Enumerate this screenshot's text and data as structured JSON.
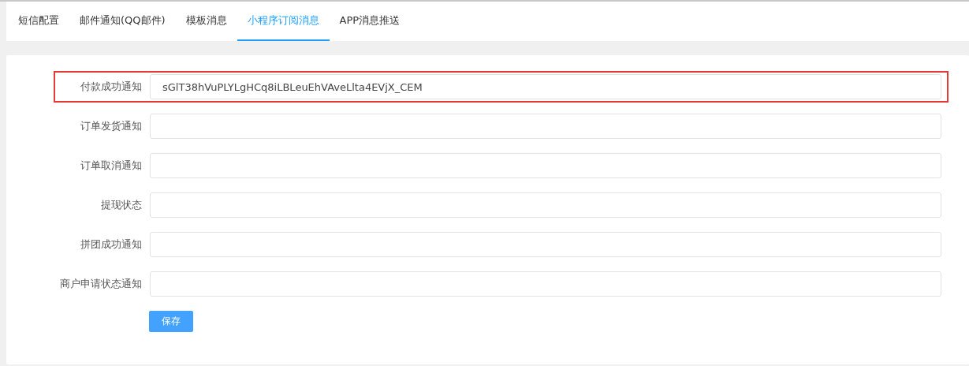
{
  "tabs": [
    {
      "label": "短信配置",
      "selected": false
    },
    {
      "label": "邮件通知(QQ邮件)",
      "selected": false
    },
    {
      "label": "模板消息",
      "selected": false
    },
    {
      "label": "小程序订阅消息",
      "selected": true
    },
    {
      "label": "APP消息推送",
      "selected": false
    }
  ],
  "fields": [
    {
      "label": "付款成功通知",
      "value": "sGlT38hVuPLYLgHCq8iLBLeuEhVAveLlta4EVjX_CEM",
      "highlighted": true
    },
    {
      "label": "订单发货通知",
      "highlighted": false
    },
    {
      "label": "订单取消通知",
      "highlighted": false
    },
    {
      "label": "提现状态",
      "highlighted": false
    },
    {
      "label": "拼团成功通知",
      "highlighted": false
    },
    {
      "label": "商户申请状态通知",
      "highlighted": false
    }
  ],
  "save_button": "保存"
}
